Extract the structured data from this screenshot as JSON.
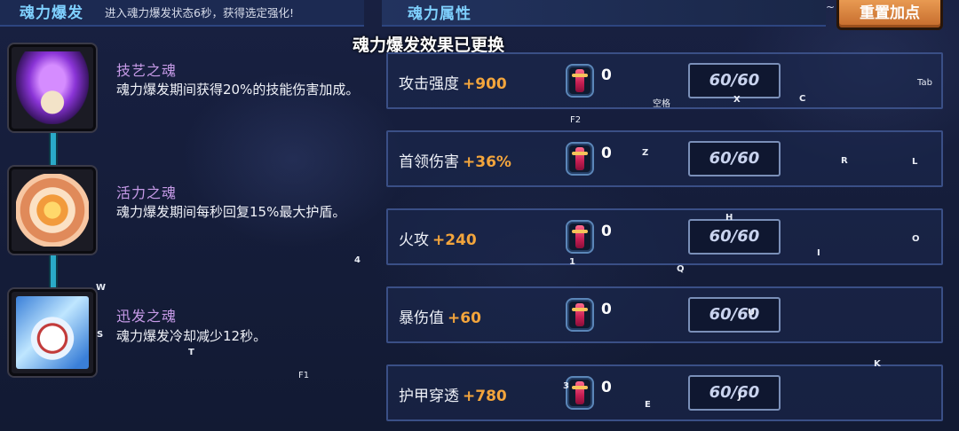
{
  "header": {
    "section_title": "魂力爆发",
    "description": "进入魂力爆发状态6秒，获得选定强化!",
    "attr_title": "魂力属性",
    "reset_button": "重置加点",
    "tilde": "~"
  },
  "notice": "魂力爆发效果已更换",
  "souls": [
    {
      "name": "技艺之魂",
      "desc": "魂力爆发期间获得20%的技能伤害加成。",
      "icon": "purple-flame-bowl-icon"
    },
    {
      "name": "活力之魂",
      "desc": "魂力爆发期间每秒回复15%最大护盾。",
      "icon": "golden-shield-icon"
    },
    {
      "name": "迅发之魂",
      "desc": "魂力爆发冷却减少12秒。",
      "icon": "clock-icon"
    }
  ],
  "attributes": [
    {
      "name": "攻击强度",
      "bonus": "+900",
      "count": "0",
      "value": "60/60"
    },
    {
      "name": "首领伤害",
      "bonus": "+36%",
      "count": "0",
      "value": "60/60"
    },
    {
      "name": "火攻",
      "bonus": "+240",
      "count": "0",
      "value": "60/60"
    },
    {
      "name": "暴伤值",
      "bonus": "+60",
      "count": "0",
      "value": "60/60"
    },
    {
      "name": "护甲穿透",
      "bonus": "+780",
      "count": "0",
      "value": "60/60"
    }
  ],
  "key_hints": {
    "space": "空格",
    "x": "X",
    "c": "C",
    "tab": "Tab",
    "f2": "F2",
    "z": "Z",
    "r": "R",
    "l": "L",
    "h": "H",
    "o": "O",
    "i": "I",
    "one": "1",
    "q": "Q",
    "four": "4",
    "w": "W",
    "u": "U",
    "s": "S",
    "t": "T",
    "k": "K",
    "f1": "F1",
    "three": "3",
    "e": "E",
    "j": "J"
  },
  "colors": {
    "accent_title": "#7fd1ff",
    "bonus": "#f3a53c",
    "soul_name": "#c79be8",
    "reset_btn": "#d8823f"
  }
}
